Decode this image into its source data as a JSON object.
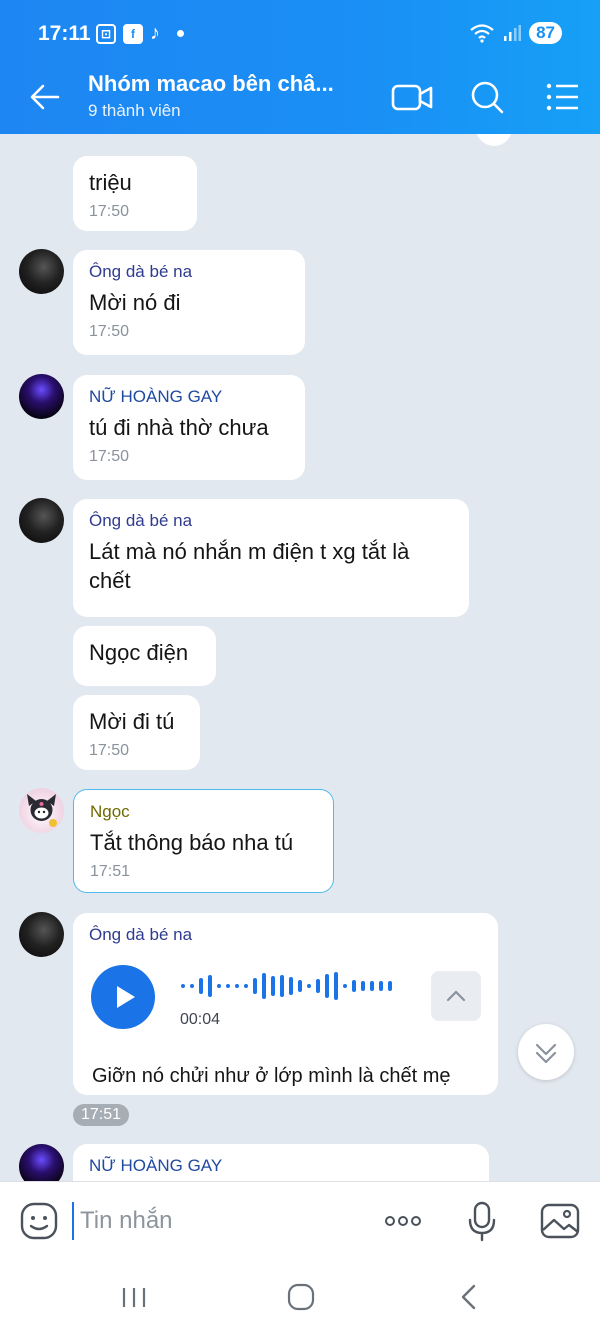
{
  "status_bar": {
    "time": "17:11",
    "battery": "87",
    "notif_icons": [
      "screen-record-icon",
      "facebook-icon",
      "tiktok-icon"
    ]
  },
  "header": {
    "title": "Nhóm macao bên châ...",
    "subtitle": "9 thành viên"
  },
  "messages": [
    {
      "sender": "",
      "text": "triệu",
      "time": "17:50"
    },
    {
      "sender": "Ông dà bé na",
      "text": "Mời nó đi",
      "time": "17:50"
    },
    {
      "sender": "NỮ HOÀNG GAY",
      "text": "tú đi nhà thờ chưa",
      "time": "17:50"
    },
    {
      "sender": "Ông dà bé na",
      "text": "Lát mà nó nhắn m điện t xg tắt là chết",
      "time": ""
    },
    {
      "sender": "",
      "text": "Ngọc điện",
      "time": ""
    },
    {
      "sender": "",
      "text": "Mời đi tú",
      "time": "17:50"
    },
    {
      "sender": "Ngọc",
      "text": "Tắt thông báo nha tú",
      "time": "17:51"
    },
    {
      "sender": "Ông dà bé na",
      "voice_duration": "00:04",
      "transcript": "Giỡn nó chửi như ở lớp mình là chết mẹ",
      "time": "17:51"
    },
    {
      "sender": "NỮ HOÀNG GAY",
      "text": "",
      "time": ""
    }
  ],
  "input": {
    "placeholder": "Tin nhắn"
  },
  "colors": {
    "header": "#1a8ff5",
    "chat_bg": "#e2e8ef",
    "accent": "#1a74e8"
  }
}
